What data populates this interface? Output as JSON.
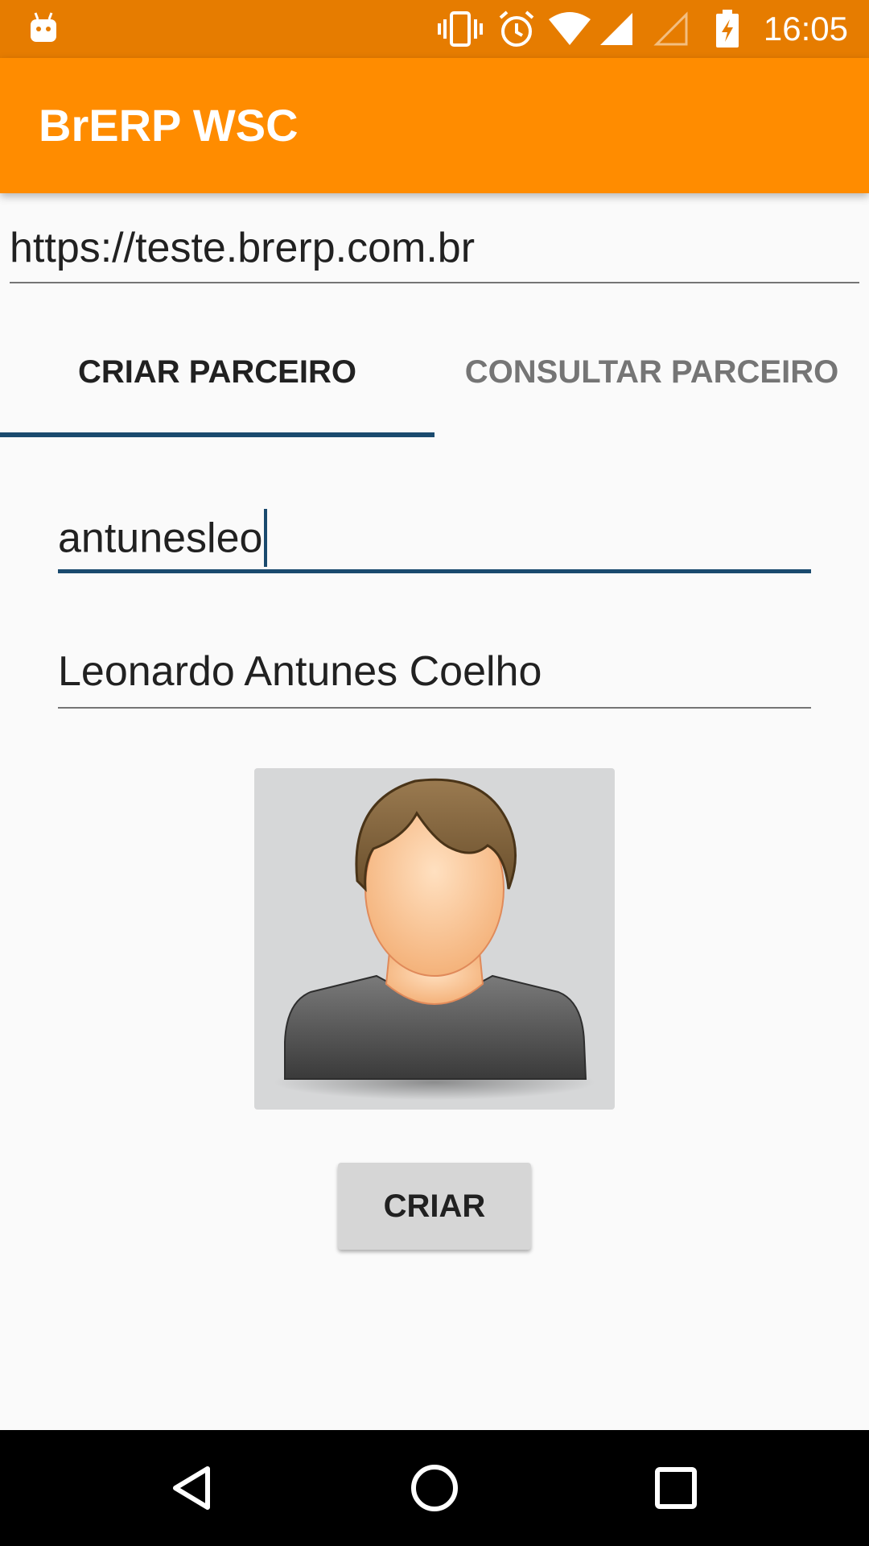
{
  "status_bar": {
    "time": "16:05",
    "icons": [
      "android-icon",
      "vibrate-icon",
      "alarm-icon",
      "wifi-icon",
      "signal-icon",
      "signal-empty-icon",
      "battery-charging-icon"
    ],
    "background_color": "#e67c00"
  },
  "app_bar": {
    "title": "BrERP WSC",
    "background_color": "#ff8c00"
  },
  "url_field": {
    "value": "https://teste.brerp.com.br"
  },
  "tabs": [
    {
      "label": "CRIAR PARCEIRO",
      "selected": true
    },
    {
      "label": "CONSULTAR PARCEIRO",
      "selected": false
    }
  ],
  "form": {
    "username_value": "antunesleo",
    "name_value": "Leonardo Antunes Coelho",
    "create_button_label": "CRIAR"
  },
  "nav_bar": {
    "buttons": [
      "back-icon",
      "home-icon",
      "recents-icon"
    ]
  },
  "colors": {
    "accent": "#1a4a6e",
    "primary": "#ff8c00",
    "primary_dark": "#e67c00"
  }
}
